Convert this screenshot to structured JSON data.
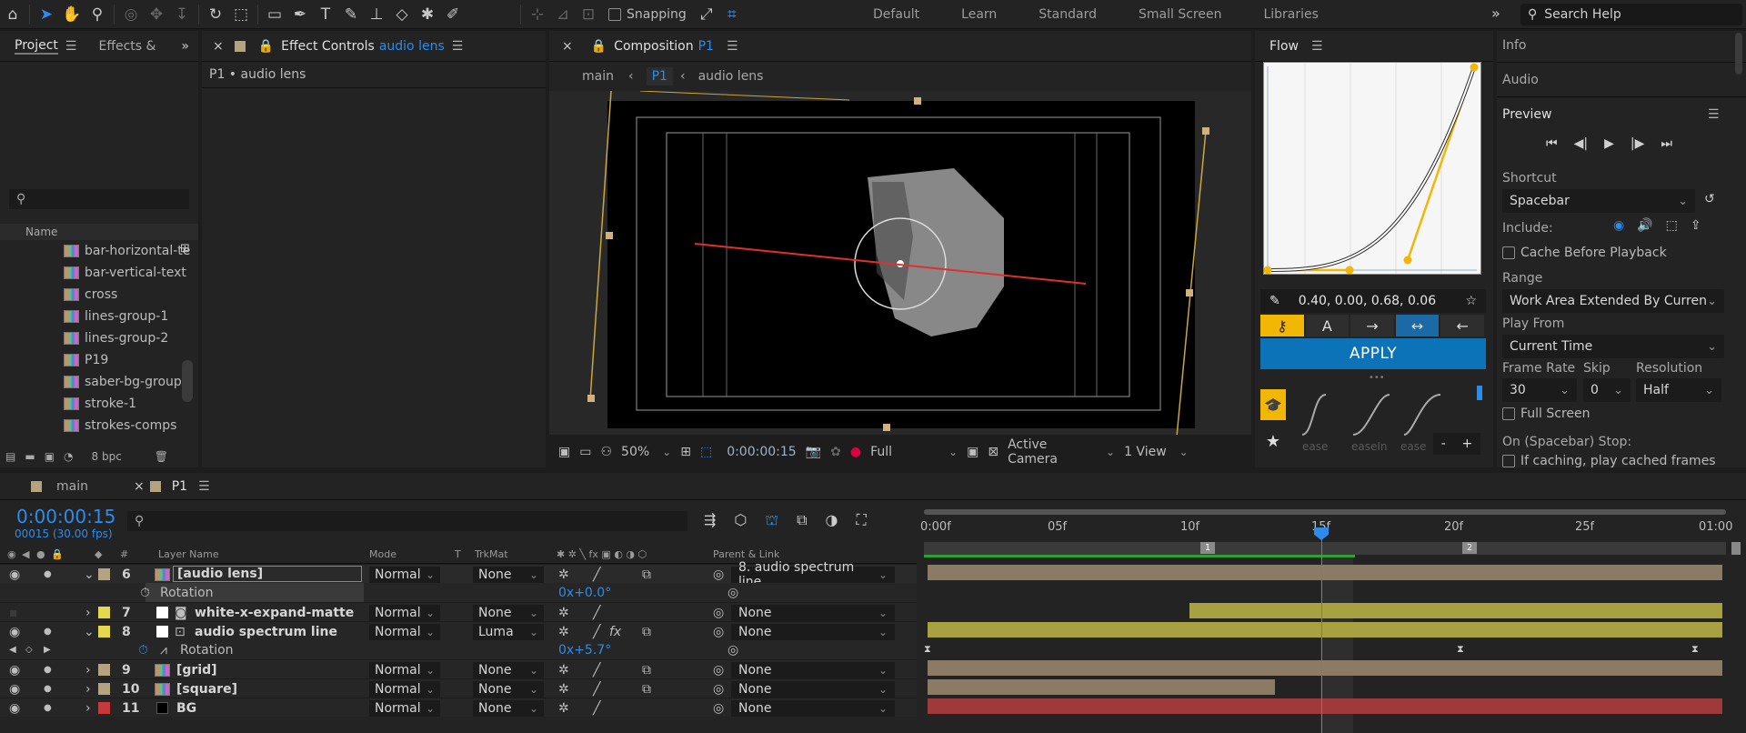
{
  "toolbar": {
    "snapping_label": "Snapping",
    "workspaces": [
      "Default",
      "Learn",
      "Standard",
      "Small Screen",
      "Libraries"
    ],
    "search_help": "Search Help"
  },
  "project": {
    "tab_project": "Project",
    "tab_effects": "Effects &",
    "search_placeholder": "",
    "col_name": "Name",
    "items": [
      "bar-horizontal-te",
      "bar-vertical-text",
      "cross",
      "lines-group-1",
      "lines-group-2",
      "P19",
      "saber-bg-group",
      "stroke-1",
      "strokes-comps"
    ],
    "bpc": "8 bpc"
  },
  "effect_controls": {
    "tab_prefix": "Effect Controls",
    "tab_layer": "audio lens",
    "subtitle": "P1 • audio lens"
  },
  "composition": {
    "tab_prefix": "Composition",
    "tab_name": "P1",
    "breadcrumb": [
      "main",
      "P1",
      "audio lens"
    ],
    "zoom": "50%",
    "timecode": "0:00:00:15",
    "resolution": "Full",
    "camera": "Active Camera",
    "views": "1 View"
  },
  "flow": {
    "title": "Flow",
    "values": "0.40, 0.00, 0.68, 0.06",
    "apply": "APPLY",
    "presets": [
      "ease",
      "easeIn",
      "ease"
    ],
    "minus": "-",
    "plus": "+"
  },
  "right_panel": {
    "info": "Info",
    "audio": "Audio",
    "preview": "Preview",
    "shortcut_label": "Shortcut",
    "shortcut_value": "Spacebar",
    "include_label": "Include:",
    "cache_before_playback": "Cache Before Playback",
    "range_label": "Range",
    "range_value": "Work Area Extended By Current...",
    "play_from_label": "Play From",
    "play_from_value": "Current Time",
    "frame_rate_label": "Frame Rate",
    "skip_label": "Skip",
    "resolution_label": "Resolution",
    "frame_rate_value": "30",
    "skip_value": "0",
    "resolution_value": "Half",
    "full_screen": "Full Screen",
    "on_stop_label": "On (Spacebar) Stop:",
    "on_stop_option": "If caching, play cached frames"
  },
  "timeline": {
    "tabs": [
      "main",
      "P1"
    ],
    "timecode": "0:00:00:15",
    "frames_fps": "00015 (30.00 fps)",
    "col_layer_name": "Layer Name",
    "col_mode": "Mode",
    "col_t": "T",
    "col_trkmat": "TrkMat",
    "col_parent": "Parent & Link",
    "ruler_labels": [
      "0:00f",
      "05f",
      "10f",
      "15f",
      "20f",
      "25f",
      "01:00"
    ],
    "markers": [
      "1",
      "2"
    ],
    "layers": [
      {
        "num": "6",
        "name": "[audio lens]",
        "mode": "Normal",
        "trkmat": "None",
        "parent": "8. audio spectrum line",
        "label_color": "#b5a281"
      },
      {
        "prop": "Rotation",
        "value": "0x+0.0°"
      },
      {
        "num": "7",
        "name": "white-x-expand-matte",
        "mode": "Normal",
        "trkmat": "None",
        "parent": "None",
        "label_color": "#e6d84c"
      },
      {
        "num": "8",
        "name": "audio spectrum line",
        "mode": "Normal",
        "trkmat": "Luma",
        "parent": "None",
        "label_color": "#e6d84c"
      },
      {
        "prop": "Rotation",
        "value": "0x+5.7°"
      },
      {
        "num": "9",
        "name": "[grid]",
        "mode": "Normal",
        "trkmat": "None",
        "parent": "None",
        "label_color": "#b5a281"
      },
      {
        "num": "10",
        "name": "[square]",
        "mode": "Normal",
        "trkmat": "None",
        "parent": "None",
        "label_color": "#b5a281"
      },
      {
        "num": "11",
        "name": "BG",
        "mode": "Normal",
        "trkmat": "None",
        "parent": "None",
        "label_color": "#c43a3a"
      }
    ]
  },
  "colors": {
    "accent_blue": "#2d8ceb",
    "flow_yellow": "#f2b705",
    "apply_blue": "#0d73b9",
    "bar_tan": "#8c7b64",
    "bar_yellow": "#a8a142",
    "bar_red": "#9e3a3a"
  }
}
